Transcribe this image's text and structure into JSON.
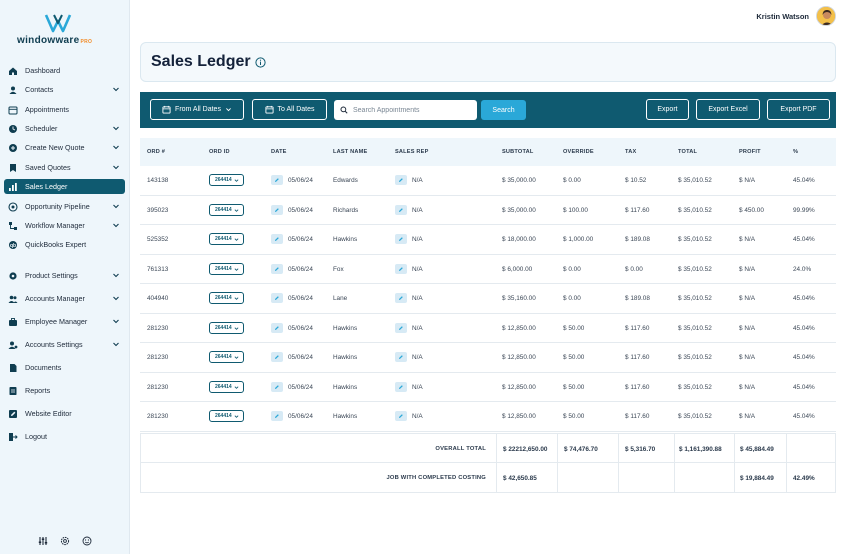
{
  "app": {
    "brand": "windowware",
    "brand_suffix": "PRO"
  },
  "user": {
    "name": "Kristin Watson"
  },
  "sidebar": {
    "items": [
      {
        "label": "Dashboard",
        "icon": "home-icon",
        "chevron": false
      },
      {
        "label": "Contacts",
        "icon": "contacts-icon",
        "chevron": true
      },
      {
        "label": "Appointments",
        "icon": "calendar-icon",
        "chevron": false
      },
      {
        "label": "Scheduler",
        "icon": "clock-icon",
        "chevron": true
      },
      {
        "label": "Create New Quote",
        "icon": "plus-circle-icon",
        "chevron": true
      },
      {
        "label": "Saved Quotes",
        "icon": "bookmark-icon",
        "chevron": true
      },
      {
        "label": "Sales Ledger",
        "icon": "bar-chart-icon",
        "chevron": false,
        "active": true
      },
      {
        "label": "Opportunity Pipeline",
        "icon": "pipeline-icon",
        "chevron": true
      },
      {
        "label": "Workflow Manager",
        "icon": "workflow-icon",
        "chevron": true
      },
      {
        "label": "QuickBooks Expert",
        "icon": "quickbooks-icon",
        "chevron": false
      },
      {
        "label": "Product Settings",
        "icon": "gear-icon",
        "chevron": true
      },
      {
        "label": "Accounts Manager",
        "icon": "users-icon",
        "chevron": true
      },
      {
        "label": "Employee Manager",
        "icon": "employee-icon",
        "chevron": true
      },
      {
        "label": "Accounts Settings",
        "icon": "user-gear-icon",
        "chevron": true
      },
      {
        "label": "Documents",
        "icon": "document-icon",
        "chevron": false
      },
      {
        "label": "Reports",
        "icon": "report-icon",
        "chevron": false
      },
      {
        "label": "Website Editor",
        "icon": "edit-icon",
        "chevron": false
      },
      {
        "label": "Logout",
        "icon": "logout-icon",
        "chevron": false
      }
    ]
  },
  "page": {
    "title": "Sales Ledger"
  },
  "toolbar": {
    "from_dates": "From All Dates",
    "to_dates": "To All Dates",
    "search_placeholder": "Search Appointments",
    "search_label": "Search",
    "export_label": "Export",
    "export_excel_label": "Export Excel",
    "export_pdf_label": "Export PDF"
  },
  "table": {
    "headers": [
      "ORD #",
      "ORD ID",
      "DATE",
      "LAST NAME",
      "SALES REP",
      "SUBTOTAL",
      "OVERRIDE",
      "TAX",
      "TOTAL",
      "PROFIT",
      "%"
    ],
    "rows": [
      {
        "ord": "143138",
        "ord_id": "264414",
        "date": "05/06/24",
        "last": "Edwards",
        "rep": "N/A",
        "subtotal": "$ 35,000.00",
        "override": "$ 0.00",
        "tax": "$ 10.52",
        "total": "$ 35,010.52",
        "profit": "$ N/A",
        "pct": "45.04%"
      },
      {
        "ord": "395023",
        "ord_id": "264414",
        "date": "05/06/24",
        "last": "Richards",
        "rep": "N/A",
        "subtotal": "$ 35,000.00",
        "override": "$ 100.00",
        "tax": "$ 117.60",
        "total": "$ 35,010.52",
        "profit": "$ 450.00",
        "pct": "99.99%"
      },
      {
        "ord": "525352",
        "ord_id": "264414",
        "date": "05/06/24",
        "last": "Hawkins",
        "rep": "N/A",
        "subtotal": "$ 18,000.00",
        "override": "$ 1,000.00",
        "tax": "$ 189.08",
        "total": "$ 35,010.52",
        "profit": "$ N/A",
        "pct": "45.04%"
      },
      {
        "ord": "761313",
        "ord_id": "264414",
        "date": "05/06/24",
        "last": "Fox",
        "rep": "N/A",
        "subtotal": "$ 6,000.00",
        "override": "$ 0.00",
        "tax": "$ 0.00",
        "total": "$ 35,010.52",
        "profit": "$ N/A",
        "pct": "24.0%"
      },
      {
        "ord": "404940",
        "ord_id": "264414",
        "date": "05/06/24",
        "last": "Lane",
        "rep": "N/A",
        "subtotal": "$ 35,160.00",
        "override": "$ 0.00",
        "tax": "$ 189.08",
        "total": "$ 35,010.52",
        "profit": "$ N/A",
        "pct": "45.04%"
      },
      {
        "ord": "281230",
        "ord_id": "264414",
        "date": "05/06/24",
        "last": "Hawkins",
        "rep": "N/A",
        "subtotal": "$ 12,850.00",
        "override": "$ 50.00",
        "tax": "$ 117.60",
        "total": "$ 35,010.52",
        "profit": "$ N/A",
        "pct": "45.04%"
      },
      {
        "ord": "281230",
        "ord_id": "264414",
        "date": "05/06/24",
        "last": "Hawkins",
        "rep": "N/A",
        "subtotal": "$ 12,850.00",
        "override": "$ 50.00",
        "tax": "$ 117.60",
        "total": "$ 35,010.52",
        "profit": "$ N/A",
        "pct": "45.04%"
      },
      {
        "ord": "281230",
        "ord_id": "264414",
        "date": "05/06/24",
        "last": "Hawkins",
        "rep": "N/A",
        "subtotal": "$ 12,850.00",
        "override": "$ 50.00",
        "tax": "$ 117.60",
        "total": "$ 35,010.52",
        "profit": "$ N/A",
        "pct": "45.04%"
      },
      {
        "ord": "281230",
        "ord_id": "264414",
        "date": "05/06/24",
        "last": "Hawkins",
        "rep": "N/A",
        "subtotal": "$ 12,850.00",
        "override": "$ 50.00",
        "tax": "$ 117.60",
        "total": "$ 35,010.52",
        "profit": "$ N/A",
        "pct": "45.04%"
      }
    ]
  },
  "totals": {
    "overall": {
      "label": "OVERALL TOTAL",
      "subtotal": "$ 22212,650.00",
      "override": "$ 74,476.70",
      "tax": "$ 5,316.70",
      "total": "$ 1,161,390.88",
      "profit": "$ 45,884.49"
    },
    "completed": {
      "label": "JOB WITH COMPLETED COSTING",
      "subtotal": "$ 42,650.85",
      "profit": "$ 19,884.49",
      "pct": "42.49%"
    }
  },
  "colors": {
    "primary": "#0f5a70",
    "accent": "#2aa8d8",
    "sidebar_bg": "#eef6fb",
    "brand_orange": "#f28c28"
  }
}
